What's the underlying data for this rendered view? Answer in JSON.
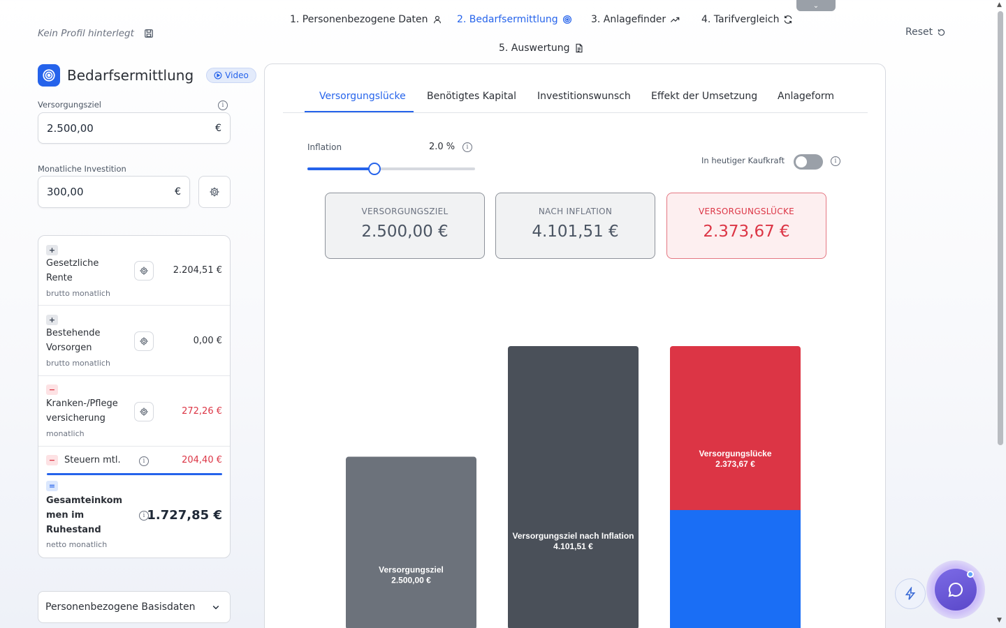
{
  "header": {
    "profile_text": "Kein Profil hinterlegt",
    "steps": [
      {
        "label": "1. Personenbezogene Daten",
        "icon": "user-icon"
      },
      {
        "label": "2. Bedarfsermittlung",
        "icon": "target-icon"
      },
      {
        "label": "3. Anlagefinder",
        "icon": "trend-up-icon"
      },
      {
        "label": "4. Tarifvergleich",
        "icon": "refresh-icon"
      },
      {
        "label": "5. Auswertung",
        "icon": "document-icon"
      }
    ],
    "reset_label": "Reset"
  },
  "sidebar": {
    "title": "Bedarfsermittlung",
    "video_label": "Video",
    "versorgungsziel": {
      "label": "Versorgungsziel",
      "value": "2.500,00",
      "unit": "€"
    },
    "investition": {
      "label": "Monatliche Investition",
      "value": "300,00",
      "unit": "€"
    },
    "income_rows": [
      {
        "sign": "+",
        "label_line1": "Gesetzliche",
        "label_line2": "Rente",
        "sub": "brutto monatlich",
        "value": "2.204,51 €"
      },
      {
        "sign": "+",
        "label_line1": "Bestehende",
        "label_line2": "Vorsorgen",
        "sub": "brutto monatlich",
        "value": "0,00 €"
      },
      {
        "sign": "−",
        "label_line1": "Kranken-/Pflege",
        "label_line2": "versicherung",
        "sub": "monatlich",
        "value": "272,26 €"
      }
    ],
    "steuern": {
      "sign": "−",
      "label": "Steuern mtl.",
      "value": "204,40 €"
    },
    "gesamt": {
      "sign": "=",
      "line1": "Gesamteinkom",
      "line2": "men im",
      "line3": "Ruhestand",
      "sub": "netto monatlich",
      "value": "1.727,85 €"
    },
    "basisdaten_label": "Personenbezogene Basisdaten"
  },
  "main": {
    "tabs": [
      "Versorgungslücke",
      "Benötigtes Kapital",
      "Investitionswunsch",
      "Effekt der Umsetzung",
      "Anlageform"
    ],
    "active_tab": 0,
    "inflation": {
      "label": "Inflation",
      "value": "2.0 %",
      "level_percent": 40
    },
    "kaufkraft_label": "In heutiger Kaufkraft",
    "stats": [
      {
        "label": "VERSORGUNGSZIEL",
        "value": "2.500,00 €"
      },
      {
        "label": "NACH INFLATION",
        "value": "4.101,51 €"
      },
      {
        "label": "VERSORGUNGSLÜCKE",
        "value": "2.373,67 €"
      }
    ]
  },
  "chart_data": {
    "type": "bar",
    "categories": [
      "Versorgungsziel",
      "Versorgungsziel nach Inflation",
      "Versorgungslücke"
    ],
    "bars": [
      {
        "label": "Versorgungsziel",
        "value_label": "2.500,00 €",
        "value": 2500.0,
        "base": 0,
        "color": "#6c727b"
      },
      {
        "label": "Versorgungsziel nach Inflation",
        "value_label": "4.101,51 €",
        "value": 4101.51,
        "base": 0,
        "color": "#4a5059"
      },
      {
        "label": "Versorgungslücke",
        "value_label": "2.373,67 €",
        "value": 2373.67,
        "base": 1727.84,
        "color": "#dc3545"
      }
    ],
    "gesamteinkommen_segment": {
      "value": 1727.84,
      "color": "#1a6ef5"
    },
    "colors": {
      "accent": "#2563eb",
      "gap": "#dc3545",
      "income": "#1a6ef5"
    }
  }
}
